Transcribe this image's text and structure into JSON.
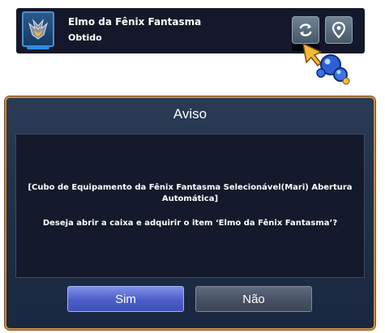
{
  "item_notice": {
    "item_name": "Elmo da Fênix Fantasma",
    "status": "Obtido",
    "icon": "phoenix-helmet-icon",
    "refresh_icon": "refresh-icon",
    "locate_icon": "map-pin-icon"
  },
  "cursor_icon": "pointer-cursor-icon",
  "dialog": {
    "title": "Aviso",
    "message_line1": "[Cubo de Equipamento da Fênix Fantasma Selecionável(Mari) Abertura Automática]",
    "message_line2": "Deseja abrir a caixa e adquirir o item ‘Elmo da Fênix Fantasma’?",
    "confirm_label": "Sim",
    "cancel_label": "Não"
  },
  "colors": {
    "dialog_border": "#c98c3c",
    "confirm_button": "#5566d0",
    "cancel_button": "#4b5667",
    "item_frame": "#4b8fd0"
  }
}
